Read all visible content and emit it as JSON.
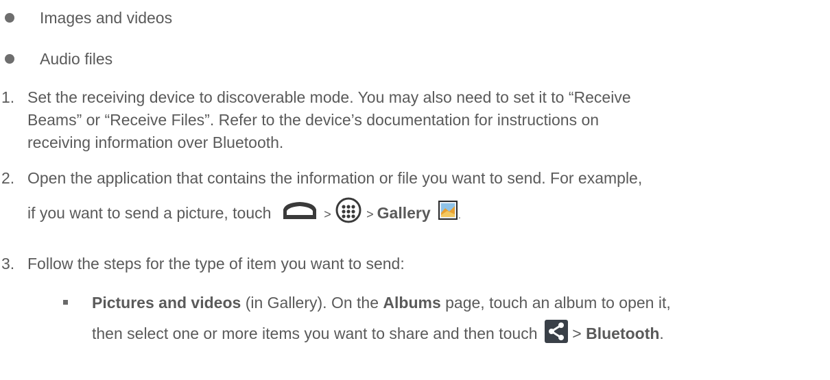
{
  "bullets": [
    "Images and videos",
    "Audio files"
  ],
  "steps": {
    "s1": {
      "num": "1.",
      "line1": "Set the receiving device to discoverable mode. You may also need to set it to “Receive",
      "line2": "Beams” or “Receive Files”. Refer to the device’s documentation for instructions on",
      "line3": "receiving information over Bluetooth."
    },
    "s2": {
      "num": "2.",
      "line1": "Open the application that contains the information or file you want to send. For example,",
      "line2_pre": "if you want to send a picture, touch ",
      "sep1": " > ",
      "sep2": " > ",
      "gallery": "Gallery",
      "period": "."
    },
    "s3": {
      "num": "3.",
      "line1": "Follow the steps for the type of item you want to send:",
      "sub": {
        "bold1": "Pictures and videos",
        "text1": " (in Gallery). On the ",
        "bold2": "Albums",
        "text2": " page, touch an album  to open it,",
        "line2_pre": "then select one or more items you want to share and then touch ",
        "sep": " > ",
        "bold3": "Bluetooth",
        "period": "."
      }
    }
  },
  "icons": {
    "home": "home-icon",
    "apps": "apps-icon",
    "gallery": "gallery-icon",
    "share": "share-icon"
  }
}
